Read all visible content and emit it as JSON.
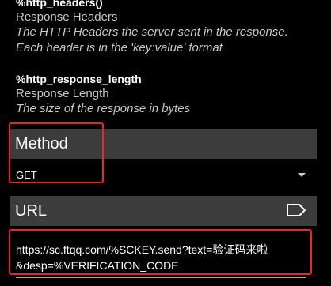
{
  "variables": [
    {
      "name": "%http_headers()",
      "title": "Response Headers",
      "description_lines": [
        "The HTTP Headers the server sent in the response.",
        "Each header is in the 'key:value' format"
      ]
    },
    {
      "name": "%http_response_length",
      "title": "Response Length",
      "description_lines": [
        "The size of the response in bytes"
      ]
    }
  ],
  "method": {
    "label": "Method",
    "selected_value": "GET"
  },
  "url": {
    "label": "URL",
    "icon": "tag-icon",
    "value_lines": [
      "https://sc.ftqq.com/%SCKEY.send?text=验证码来啦",
      "&desp=%VERIFICATION_CODE"
    ]
  },
  "colors": {
    "background": "#000000",
    "section_header": "#3c3c3c",
    "input_underline": "#c7b400",
    "highlight_box": "#e8262b"
  }
}
